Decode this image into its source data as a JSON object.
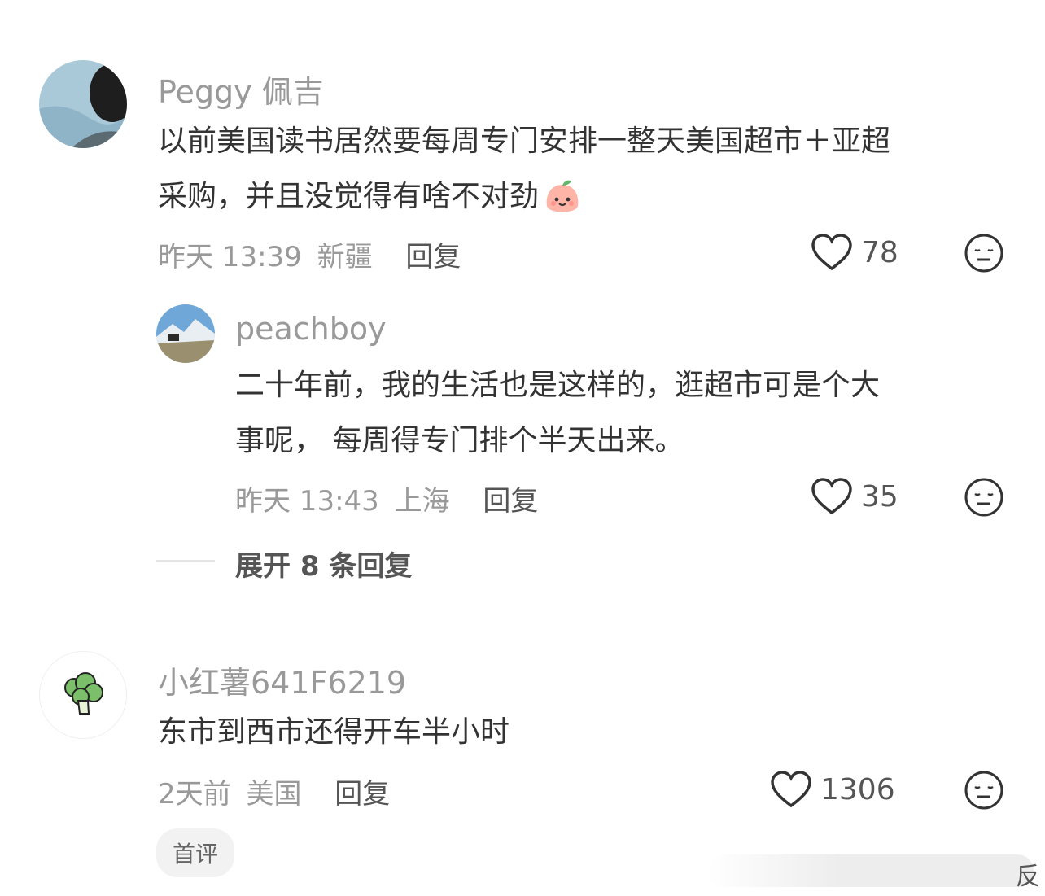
{
  "comments": [
    {
      "username": "Peggy 佩吉",
      "text_line1": "以前美国读书居然要每周专门安排一整天美国超市＋亚超",
      "text_line2": "采购，并且没觉得有啥不对劲",
      "time": "昨天 13:39",
      "location": "新疆",
      "reply_label": "回复",
      "likes": "78",
      "emoji_icon": "peach-face-emoji"
    },
    {
      "username": "peachboy",
      "text_line1": "二十年前，我的生活也是这样的，逛超市可是个大",
      "text_line2": "事呢， 每周得专门排个半天出来。",
      "time": "昨天 13:43",
      "location": "上海",
      "reply_label": "回复",
      "likes": "35"
    },
    {
      "username": "小红薯641F6219",
      "text": "东市到西市还得开车半小时",
      "time": "2天前",
      "location": "美国",
      "reply_label": "回复",
      "likes": "1306",
      "tag": "首评"
    }
  ],
  "expand_replies": "展开 8 条回复",
  "watermark": "反",
  "colors": {
    "meta": "#999999",
    "text": "#333333",
    "tag_bg": "#f2f2f2"
  }
}
